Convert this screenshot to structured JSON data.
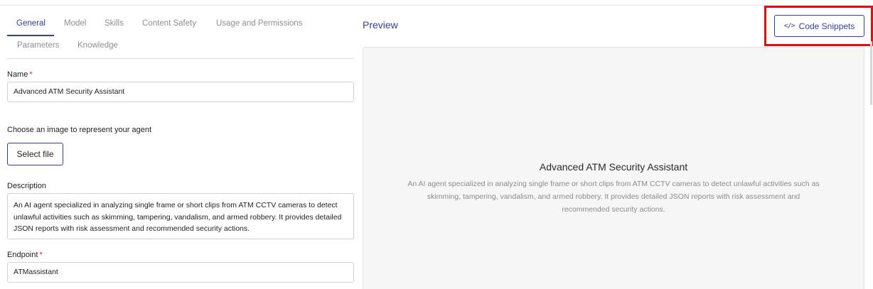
{
  "tabs": [
    {
      "label": "General",
      "active": true
    },
    {
      "label": "Model",
      "active": false
    },
    {
      "label": "Skills",
      "active": false
    },
    {
      "label": "Content Safety",
      "active": false
    },
    {
      "label": "Usage and Permissions",
      "active": false
    },
    {
      "label": "Parameters",
      "active": false
    },
    {
      "label": "Knowledge",
      "active": false
    }
  ],
  "form": {
    "name_label": "Name",
    "name_value": "Advanced ATM Security Assistant",
    "required_mark": "*",
    "image_label": "Choose an image to represent your agent",
    "select_file_label": "Select file",
    "description_label": "Description",
    "description_value": "An AI agent specialized in analyzing single frame or short clips from ATM CCTV cameras to detect unlawful activities such as skimming, tampering, vandalism, and armed robbery. It provides detailed JSON reports with risk assessment and recommended security actions.",
    "endpoint_label": "Endpoint",
    "endpoint_value": "ATMassistant"
  },
  "preview": {
    "title": "Preview",
    "code_snippets_label": "Code Snippets",
    "code_icon": "</>",
    "agent_name": "Advanced ATM Security Assistant",
    "agent_description": "An AI agent specialized in analyzing single frame or short clips from ATM CCTV cameras to detect unlawful activities such as skimming, tampering, vandalism, and armed robbery. It provides detailed JSON reports with risk assessment and recommended security actions."
  },
  "colors": {
    "accent": "#2e3fae",
    "highlight": "#e01010",
    "required": "#e02020"
  }
}
